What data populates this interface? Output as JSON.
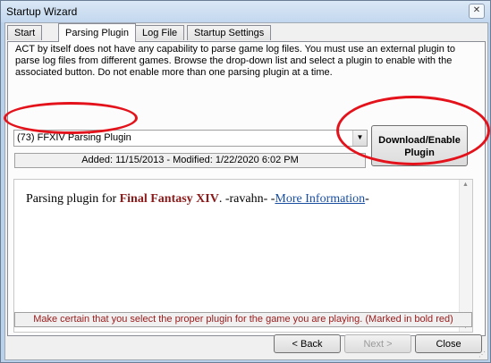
{
  "window": {
    "title": "Startup Wizard",
    "close_glyph": "✕"
  },
  "tabs": [
    {
      "label": "Start"
    },
    {
      "label": "Parsing Plugin"
    },
    {
      "label": "Log File"
    },
    {
      "label": "Startup Settings"
    }
  ],
  "active_tab": "Parsing Plugin",
  "panel": {
    "description": "ACT by itself does not have any capability to parse game log files.  You must use an external plugin to parse log files from different games.  Browse the drop-down list and select a plugin to enable with the associated button.  Do not enable more than one parsing plugin at a time.",
    "plugin_select": {
      "value": "(73) FFXIV Parsing Plugin",
      "arrow_glyph": "▼"
    },
    "added_modified": "Added: 11/15/2013 - Modified: 1/22/2020 6:02 PM",
    "download_button": {
      "line1": "Download/Enable",
      "line2": "Plugin"
    },
    "info": {
      "prefix": "Parsing plugin for ",
      "game": "Final Fantasy XIV",
      "middle": ". -ravahn- -",
      "link": "More Information",
      "suffix": "-"
    },
    "warning": "Make certain that you select the proper plugin for the game you are playing.  (Marked in bold red)"
  },
  "buttons": {
    "back": "< Back",
    "next": "Next >",
    "close": "Close"
  },
  "icons": {
    "scroll_up": "▲",
    "scroll_down": "▼",
    "grip": "⋰"
  },
  "colors": {
    "highlight_ring": "#e3121b",
    "game_name": "#8b1a1a",
    "warning_text": "#9a1a1a",
    "link": "#1a4fa0"
  }
}
